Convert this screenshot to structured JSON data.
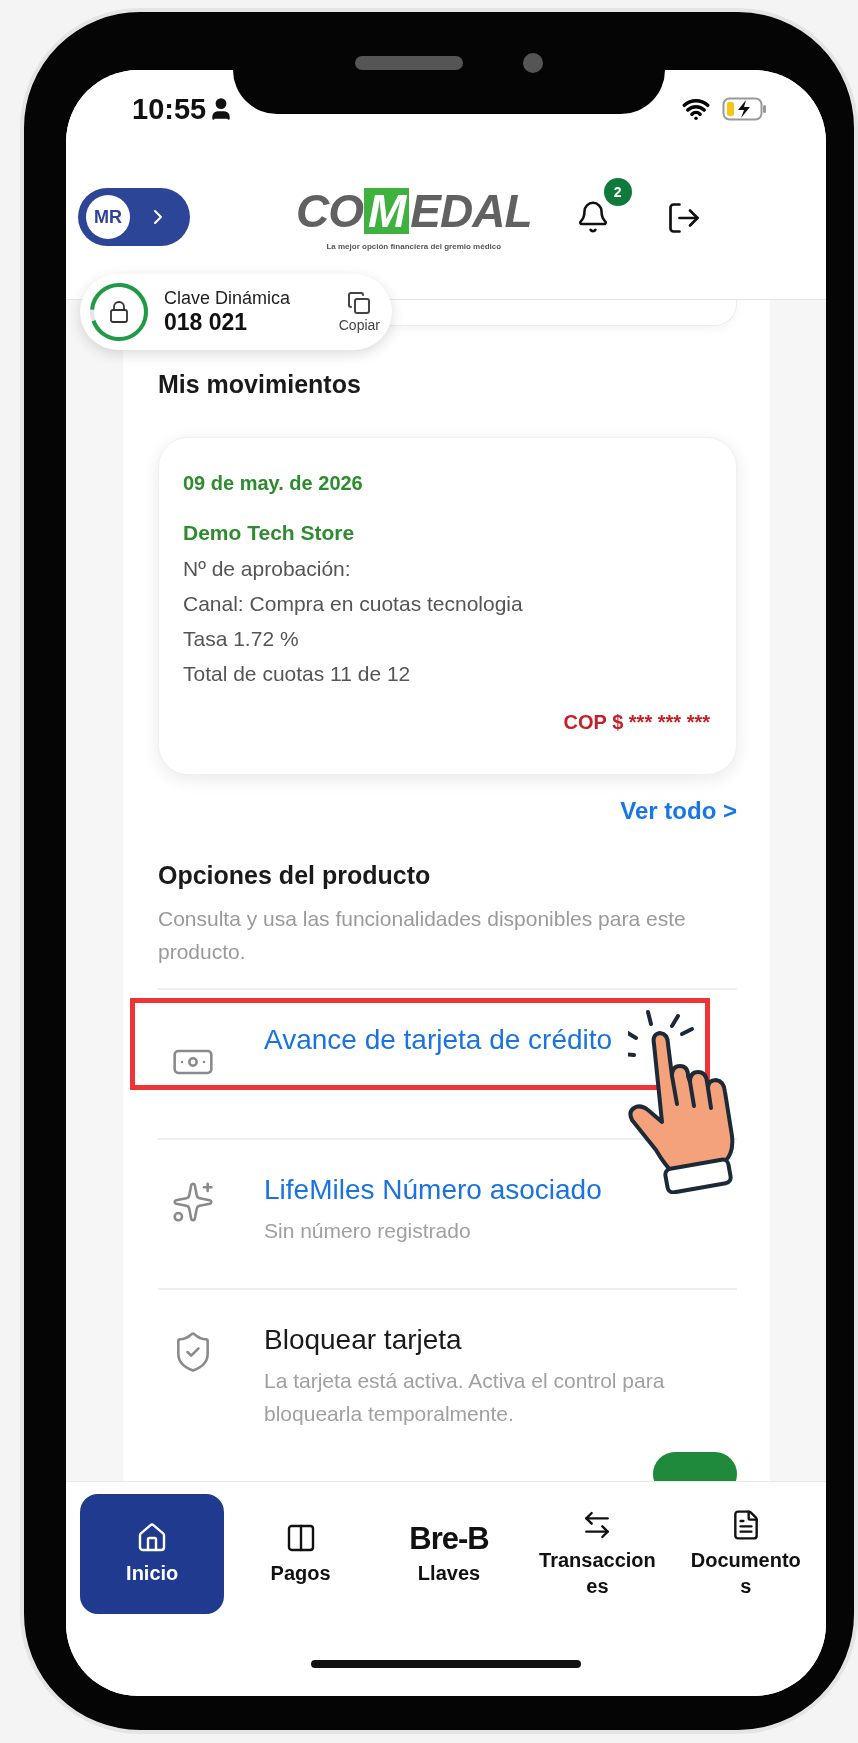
{
  "status_bar": {
    "time": "10:55"
  },
  "header": {
    "avatar": {
      "initials": "MR"
    },
    "logo": {
      "before": "CO",
      "boxed": "M",
      "after": "EDAL",
      "tagline": "La mejor opción financiera del gremio médico"
    },
    "notifications": {
      "count": "2"
    }
  },
  "dynamic_key": {
    "label": "Clave Dinámica",
    "code": "018 021",
    "copy_label": "Copiar",
    "level": 0.93
  },
  "movements": {
    "title": "Mis movimientos",
    "items": [
      {
        "date": "09 de may. de 2026",
        "merchant": "Demo Tech Store",
        "lines": [
          "Nº de aprobación:",
          "Canal: Compra en cuotas tecnologia",
          "Tasa 1.72 %",
          "Total de cuotas 11 de 12"
        ],
        "amount": "COP $ *** *** ***"
      }
    ],
    "see_all": "Ver todo >"
  },
  "product_options": {
    "title": "Opciones del producto",
    "description": "Consulta y usa las funcionalidades disponibles para este producto.",
    "items": [
      {
        "kind": "link",
        "title": "Avance de tarjeta de crédito",
        "highlighted": true
      },
      {
        "kind": "link",
        "title": "LifeMiles Número asociado",
        "subtitle": "Sin número registrado",
        "highlighted": false
      },
      {
        "kind": "toggle",
        "title": "Bloquear tarjeta",
        "subtitle": "La tarjeta está activa. Activa el control para bloquearla temporalmente.",
        "on": true,
        "highlighted": false
      }
    ]
  },
  "nav": [
    {
      "kind": "icon",
      "label": "Inicio",
      "selected": true
    },
    {
      "kind": "icon",
      "label": "Pagos",
      "selected": false
    },
    {
      "kind": "logo",
      "logo": "Bre-B",
      "label": "Llaves",
      "selected": false
    },
    {
      "kind": "icon",
      "label": "Transacciones",
      "selected": false
    },
    {
      "kind": "icon",
      "label": "Documentos",
      "selected": false
    }
  ]
}
